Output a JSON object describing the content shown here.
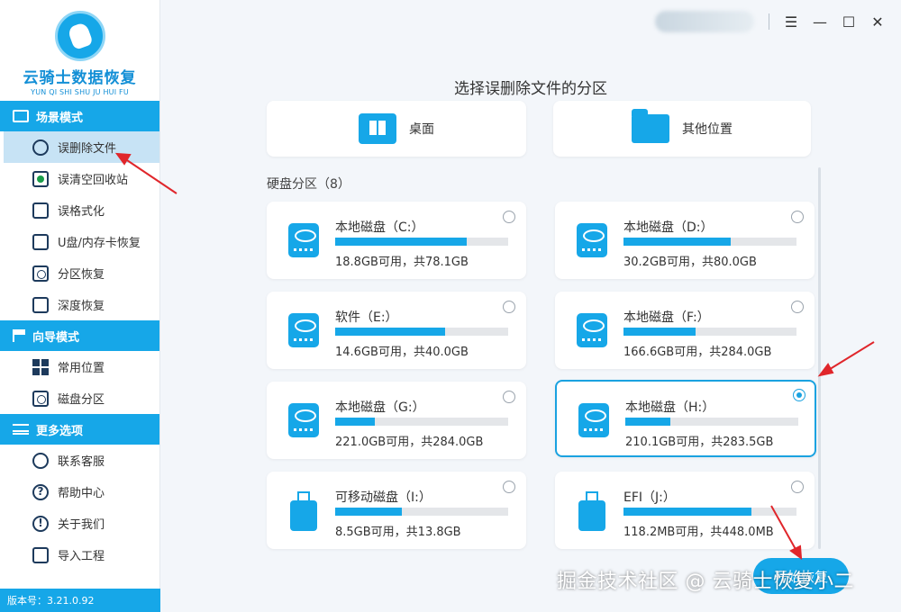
{
  "app": {
    "logo_cn": "云骑士数据恢复",
    "logo_en": "YUN QI SHI SHU JU HUI FU",
    "version": "版本号：3.21.0.92"
  },
  "sidebar": {
    "sections": [
      {
        "title": "场景模式",
        "items": [
          {
            "label": "误删除文件",
            "icon": "file-recover-icon",
            "active": true
          },
          {
            "label": "误清空回收站",
            "icon": "recycle-bin-icon"
          },
          {
            "label": "误格式化",
            "icon": "format-disk-icon"
          },
          {
            "label": "U盘/内存卡恢复",
            "icon": "usb-card-icon"
          },
          {
            "label": "分区恢复",
            "icon": "partition-icon"
          },
          {
            "label": "深度恢复",
            "icon": "deep-scan-icon"
          }
        ]
      },
      {
        "title": "向导模式",
        "items": [
          {
            "label": "常用位置",
            "icon": "windows-icon"
          },
          {
            "label": "磁盘分区",
            "icon": "disk-partition-icon"
          }
        ]
      },
      {
        "title": "更多选项",
        "items": [
          {
            "label": "联系客服",
            "icon": "phone-icon"
          },
          {
            "label": "帮助中心",
            "icon": "help-icon"
          },
          {
            "label": "关于我们",
            "icon": "info-icon"
          },
          {
            "label": "导入工程",
            "icon": "import-icon"
          }
        ]
      }
    ]
  },
  "window_controls": {
    "menu": "☰",
    "minimize": "—",
    "maximize": "☐",
    "close": "✕"
  },
  "main": {
    "title": "选择误删除文件的分区",
    "locations": [
      {
        "label": "桌面",
        "icon": "windows-desktop-icon"
      },
      {
        "label": "其他位置",
        "icon": "folder-icon"
      }
    ],
    "disk_section": "硬盘分区（8）",
    "partitions": [
      {
        "name": "本地磁盘（C:）",
        "info": "18.8GB可用，共78.1GB",
        "used_fraction": 0.76,
        "type": "drive",
        "selected": false
      },
      {
        "name": "本地磁盘（D:）",
        "info": "30.2GB可用，共80.0GB",
        "used_fraction": 0.62,
        "type": "drive",
        "selected": false
      },
      {
        "name": "软件（E:）",
        "info": "14.6GB可用，共40.0GB",
        "used_fraction": 0.635,
        "type": "drive",
        "selected": false
      },
      {
        "name": "本地磁盘（F:）",
        "info": "166.6GB可用，共284.0GB",
        "used_fraction": 0.415,
        "type": "drive",
        "selected": false
      },
      {
        "name": "本地磁盘（G:）",
        "info": "221.0GB可用，共284.0GB",
        "used_fraction": 0.23,
        "type": "drive",
        "selected": false
      },
      {
        "name": "本地磁盘（H:）",
        "info": "210.1GB可用，共283.5GB",
        "used_fraction": 0.26,
        "type": "drive",
        "selected": true
      },
      {
        "name": "可移动磁盘（I:）",
        "info": "8.5GB可用，共13.8GB",
        "used_fraction": 0.385,
        "type": "usb",
        "selected": false
      },
      {
        "name": "EFI（J:）",
        "info": "118.2MB可用，共448.0MB",
        "used_fraction": 0.74,
        "type": "usb",
        "selected": false
      }
    ],
    "start_button": "开始恢复"
  },
  "watermark": "掘金技术社区 @ 云骑士恢复小二",
  "colors": {
    "accent": "#16a7e8",
    "annotation_arrow": "#e0262b"
  }
}
